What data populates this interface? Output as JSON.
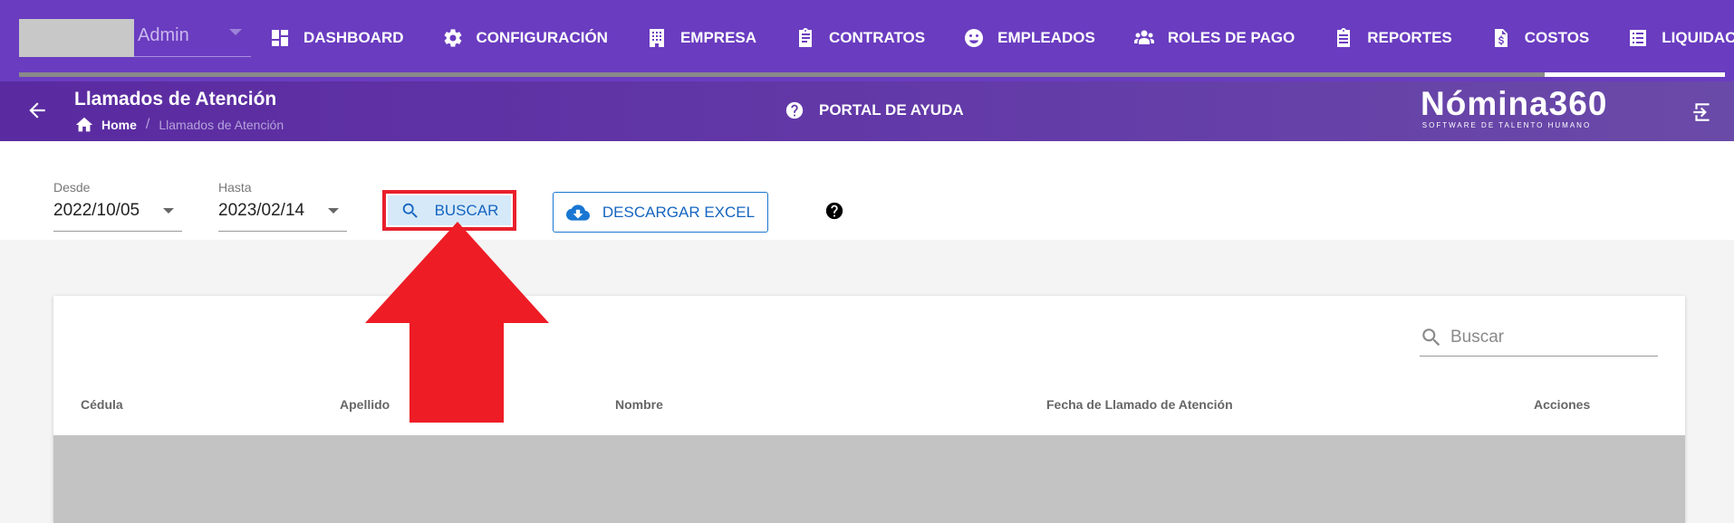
{
  "user": {
    "name": "Admin"
  },
  "nav": {
    "items": [
      {
        "label": "DASHBOARD",
        "icon": "dashboard-icon"
      },
      {
        "label": "CONFIGURACIÓN",
        "icon": "gear-icon"
      },
      {
        "label": "EMPRESA",
        "icon": "building-icon"
      },
      {
        "label": "CONTRATOS",
        "icon": "clipboard-icon"
      },
      {
        "label": "EMPLEADOS",
        "icon": "face-icon"
      },
      {
        "label": "ROLES DE PAGO",
        "icon": "people-icon"
      },
      {
        "label": "REPORTES",
        "icon": "report-clipboard-icon"
      },
      {
        "label": "COSTOS",
        "icon": "invoice-dollar-icon"
      },
      {
        "label": "LIQUIDACIONES",
        "icon": "list-icon"
      }
    ],
    "active": "LIQUIDACIONES"
  },
  "header": {
    "title": "Llamados de Atención",
    "breadcrumb_home": "Home",
    "breadcrumb_current": "Llamados de Atención",
    "help_portal": "PORTAL DE AYUDA",
    "brand_name": "Nómina360",
    "brand_tagline": "SOFTWARE DE TALENTO HUMANO"
  },
  "filters": {
    "desde_label": "Desde",
    "desde_value": "2022/10/05",
    "hasta_label": "Hasta",
    "hasta_value": "2023/02/14",
    "buscar_label": "BUSCAR",
    "excel_label": "DESCARGAR EXCEL"
  },
  "table": {
    "search_placeholder": "Buscar",
    "columns": [
      "Cédula",
      "Apellido",
      "Nombre",
      "Fecha de Llamado de Atención",
      "Acciones"
    ]
  },
  "colors": {
    "nav_bg": "#6a3cc0",
    "subheader_bg": "#5a2aa0",
    "accent_blue": "#1565c0",
    "highlight_red": "#e8202c"
  }
}
